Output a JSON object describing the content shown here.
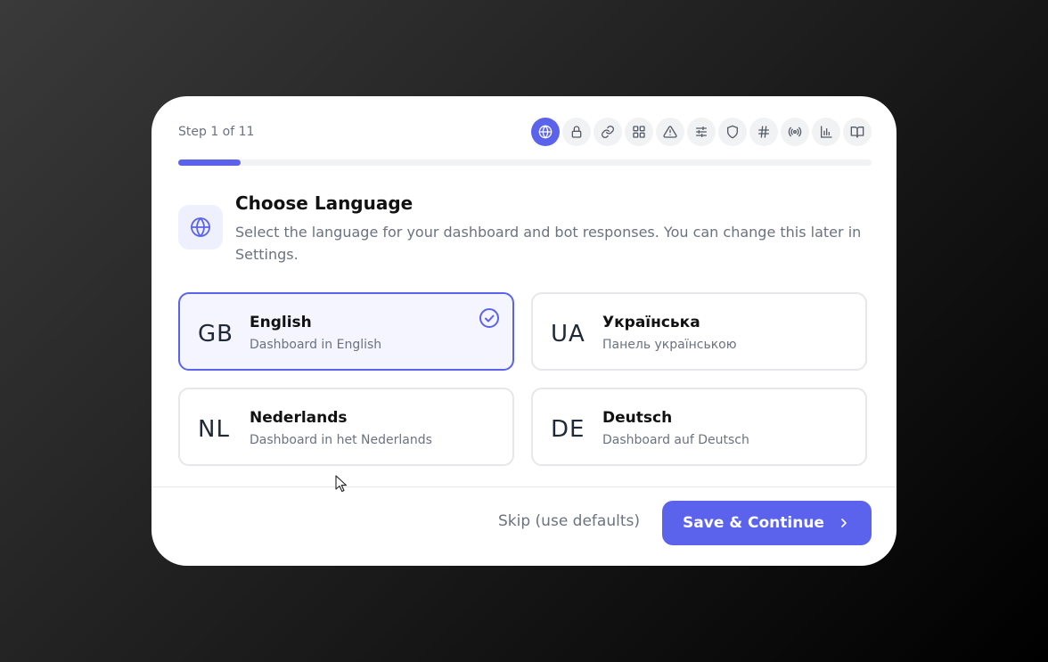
{
  "wizard": {
    "step_label": "Step 1 of 11",
    "progress_percent": 9,
    "steps": [
      {
        "icon": "globe-icon",
        "active": true
      },
      {
        "icon": "lock-icon",
        "active": false
      },
      {
        "icon": "link-icon",
        "active": false
      },
      {
        "icon": "grid-icon",
        "active": false
      },
      {
        "icon": "warning-icon",
        "active": false
      },
      {
        "icon": "sliders-icon",
        "active": false
      },
      {
        "icon": "shield-icon",
        "active": false
      },
      {
        "icon": "hash-icon",
        "active": false
      },
      {
        "icon": "broadcast-icon",
        "active": false
      },
      {
        "icon": "chart-icon",
        "active": false
      },
      {
        "icon": "book-icon",
        "active": false
      }
    ]
  },
  "header": {
    "icon": "globe-icon",
    "title": "Choose Language",
    "subtitle": "Select the language for your dashboard and bot responses. You can change this later in Settings."
  },
  "languages": [
    {
      "code": "GB",
      "name": "English",
      "description": "Dashboard in English",
      "selected": true
    },
    {
      "code": "UA",
      "name": "Українська",
      "description": "Панель українською",
      "selected": false
    },
    {
      "code": "NL",
      "name": "Nederlands",
      "description": "Dashboard in het Nederlands",
      "selected": false
    },
    {
      "code": "DE",
      "name": "Deutsch",
      "description": "Dashboard auf Deutsch",
      "selected": false
    }
  ],
  "footer": {
    "skip_label": "Skip (use defaults)",
    "save_label": "Save & Continue"
  },
  "colors": {
    "accent": "#5b63ec",
    "selected_bg": "#f4f5ff"
  }
}
